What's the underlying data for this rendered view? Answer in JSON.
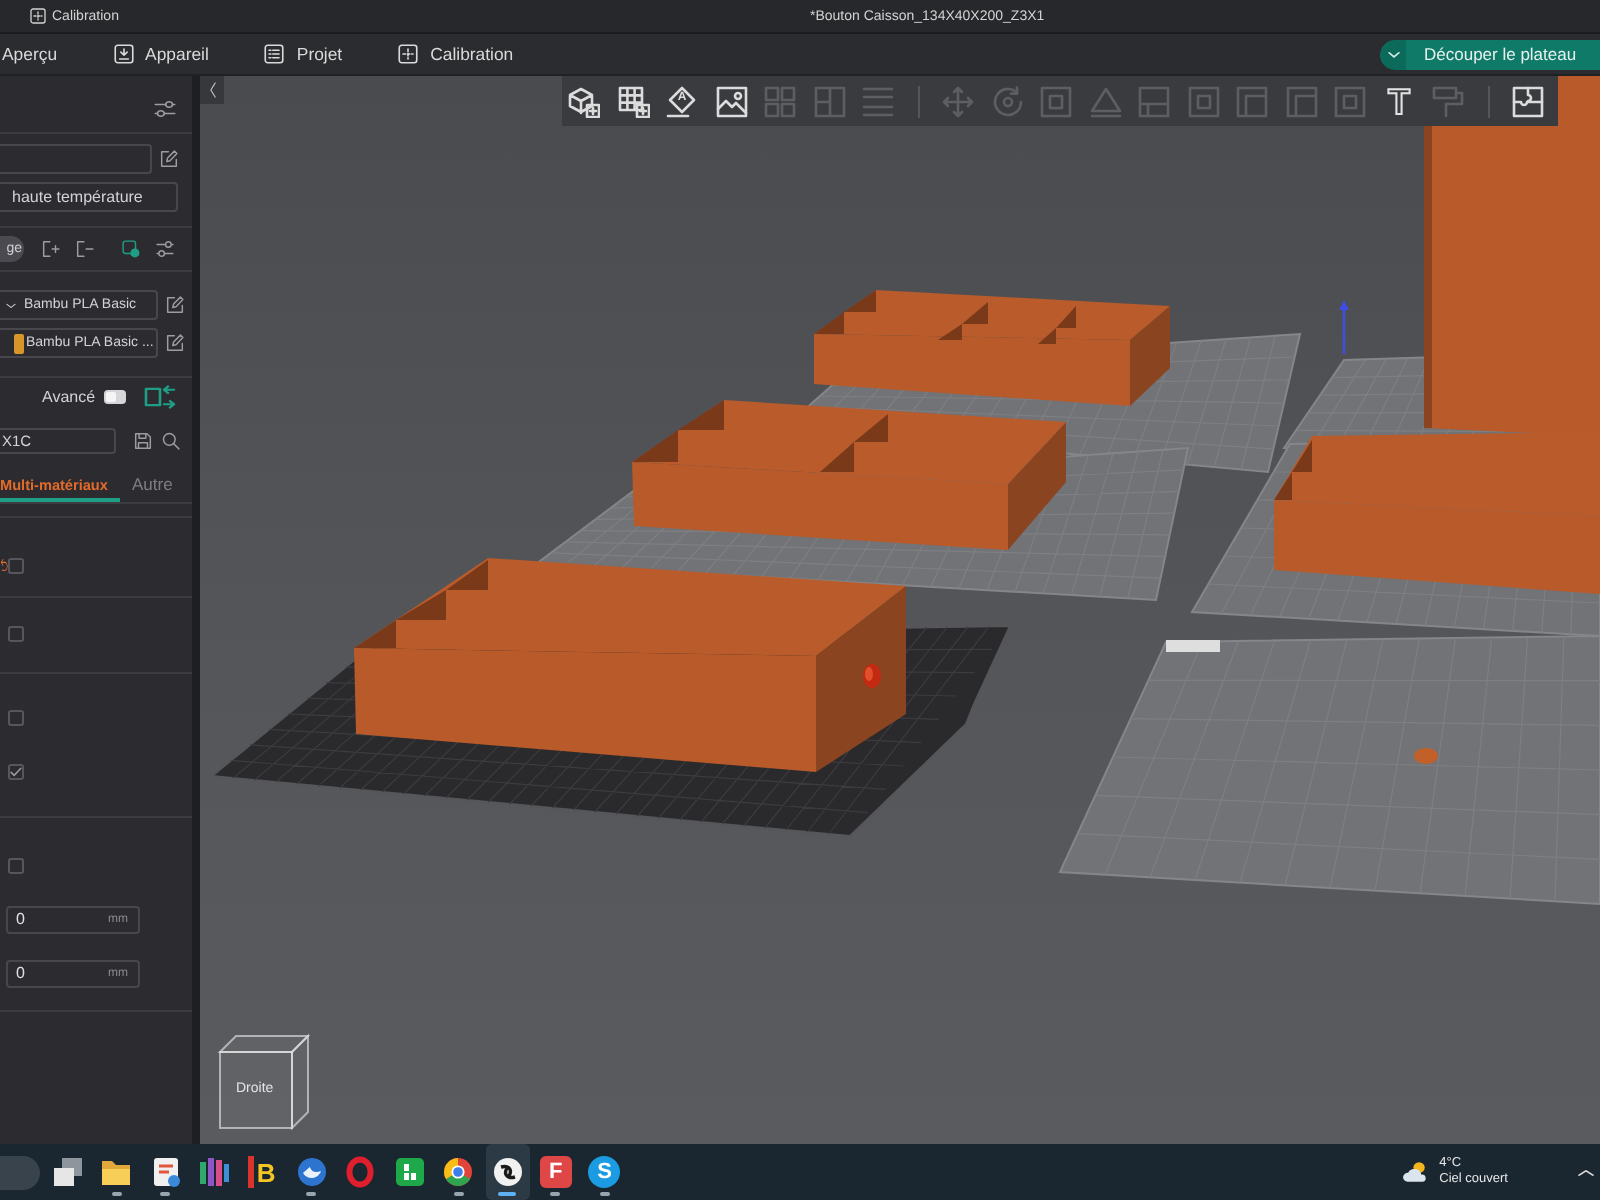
{
  "window": {
    "app_menu": "Calibration",
    "title": "*Bouton Caisson_134X40X200_Z3X1"
  },
  "tabs": [
    {
      "label": "Aperçu",
      "kind": "none",
      "selected": false
    },
    {
      "label": "Appareil",
      "kind": "device",
      "selected": false
    },
    {
      "label": "Projet",
      "kind": "list",
      "selected": false
    },
    {
      "label": "Calibration",
      "kind": "calibration",
      "selected": false
    }
  ],
  "slice_button": {
    "label": "Découper le plateau"
  },
  "sidebar": {
    "plate_type": "haute température",
    "filament_button": "ge",
    "filaments": [
      {
        "kind": "dropdown",
        "name": "Bambu PLA Basic"
      },
      {
        "kind": "swatch",
        "name": "Bambu PLA Basic ...",
        "color": "#d8952a"
      }
    ],
    "advanced": {
      "label": "Avancé",
      "on": false
    },
    "process_preset": "X1C",
    "tabs": [
      {
        "label": "Multi-matériaux",
        "selected": true
      },
      {
        "label": "Autre",
        "selected": false
      }
    ],
    "option_groups": [
      {
        "options": [
          {
            "kind": "checkbox",
            "checked": false,
            "modified": true
          }
        ]
      },
      {
        "options": [
          {
            "kind": "checkbox",
            "checked": false,
            "modified": false
          }
        ]
      },
      {
        "options": [
          {
            "kind": "checkbox",
            "checked": false,
            "modified": false
          },
          {
            "kind": "checkbox",
            "checked": true,
            "modified": false
          }
        ]
      },
      {
        "options": [
          {
            "kind": "checkbox",
            "checked": false,
            "modified": false
          },
          {
            "kind": "number",
            "value": "0",
            "unit": "mm",
            "modified": false
          },
          {
            "kind": "number",
            "value": "0",
            "unit": "mm",
            "modified": false
          }
        ]
      }
    ]
  },
  "viewport": {
    "toolbar": {
      "groups": [
        {
          "tools": [
            {
              "kind": "cube",
              "disabled": false
            },
            {
              "kind": "grid",
              "disabled": false
            },
            {
              "kind": "diamond",
              "glyph": "A",
              "disabled": false
            },
            {
              "kind": "picture",
              "disabled": false
            },
            {
              "kind": "squares",
              "disabled": true
            },
            {
              "kind": "split",
              "disabled": true
            },
            {
              "kind": "lines",
              "disabled": true
            }
          ]
        },
        {
          "tools": [
            {
              "kind": "cross",
              "disabled": true
            },
            {
              "kind": "circle",
              "disabled": true
            },
            {
              "kind": "square",
              "disabled": true
            },
            {
              "kind": "triangle",
              "disabled": true
            },
            {
              "kind": "half",
              "disabled": true
            },
            {
              "kind": "square",
              "disabled": true
            },
            {
              "kind": "corner",
              "disabled": true
            },
            {
              "kind": "corner",
              "disabled": true
            },
            {
              "kind": "square",
              "disabled": true
            },
            {
              "kind": "letter",
              "glyph": "T",
              "disabled": false
            },
            {
              "kind": "roller",
              "disabled": true
            }
          ]
        },
        {
          "tools": [
            {
              "kind": "puzzle",
              "disabled": false
            }
          ]
        }
      ]
    },
    "view_cube": {
      "label": "Droite"
    }
  },
  "taskbar": {
    "apps": [
      {
        "kind": "taskview",
        "running": false,
        "active": false
      },
      {
        "kind": "folder",
        "running": true,
        "active": false
      },
      {
        "kind": "snip",
        "running": true,
        "active": false
      },
      {
        "kind": "bars",
        "running": false,
        "active": false
      },
      {
        "kind": "letter-plain",
        "glyph": "B",
        "running": false,
        "active": false
      },
      {
        "kind": "bird",
        "running": true,
        "active": false
      },
      {
        "kind": "ring",
        "running": false,
        "active": false
      },
      {
        "kind": "tile",
        "running": false,
        "active": false
      },
      {
        "kind": "wheel",
        "running": true,
        "active": false
      },
      {
        "kind": "swirl",
        "running": true,
        "active": true
      },
      {
        "kind": "letter-tile",
        "glyph": "F",
        "running": true,
        "active": false
      },
      {
        "kind": "letter-circle",
        "glyph": "S",
        "running": true,
        "active": false
      }
    ],
    "weather": {
      "temperature": "4°C",
      "condition": "Ciel couvert"
    }
  }
}
